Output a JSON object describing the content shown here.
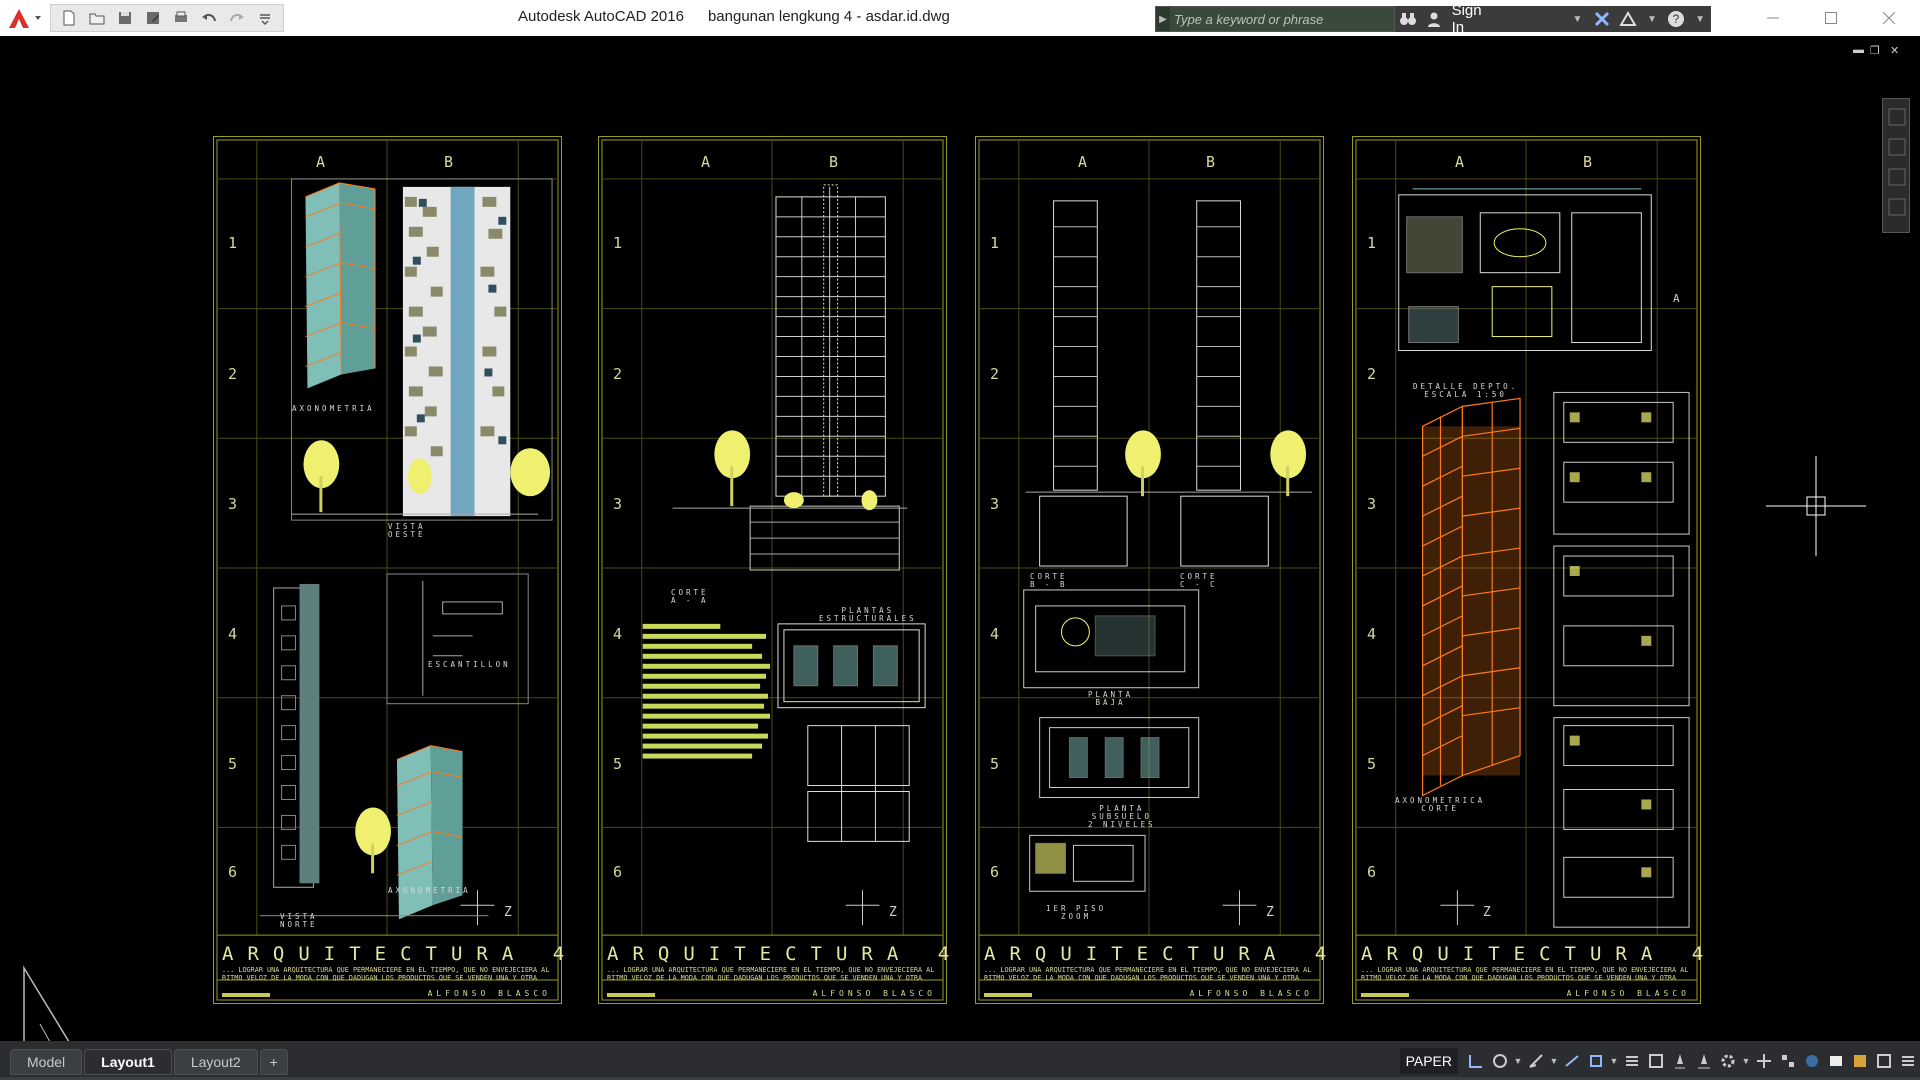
{
  "window": {
    "app_title": "Autodesk AutoCAD 2016",
    "file_title": "bangunan lengkung 4 - asdar.id.dwg"
  },
  "qat_icons": [
    "new-icon",
    "open-icon",
    "save-icon",
    "save-as-icon",
    "print-icon",
    "undo-icon",
    "redo-icon",
    "customize-icon"
  ],
  "search": {
    "placeholder": "Type a keyword or phrase"
  },
  "signin": {
    "label": "Sign In"
  },
  "sheets": [
    {
      "col_a": "A",
      "col_b": "B",
      "rows": [
        "1",
        "2",
        "3",
        "4",
        "5",
        "6"
      ],
      "labels": {
        "axonometria_top": "AXONOMETRIA",
        "vista_oeste": "VISTA\nOESTE",
        "escantillon": "ESCANTILLON",
        "vista_norte": "VISTA\nNORTE",
        "axonometria_bottom": "AXONOMETRIA"
      },
      "compass": "Z",
      "title": "ARQUITECTURA 4",
      "description": "... LOGRAR UNA ARQUITECTURA QUE PERMANECIERE EN EL TIEMPO, QUE NO ENVEJECIERA AL RITMO VELOZ DE LA MODA CON QUE DADUGAN LOS PRODUCTOS QUE SE VENDEN UNA Y OTRA VEZ, DADA TEMPORADA.",
      "author": "ALFONSO BLASCO"
    },
    {
      "col_a": "A",
      "col_b": "B",
      "rows": [
        "1",
        "2",
        "3",
        "4",
        "5",
        "6"
      ],
      "labels": {
        "corte_aa": "CORTE\nA - A",
        "plantas_estructurales": "PLANTAS\nESTRUCTURALES"
      },
      "compass": "Z",
      "title": "ARQUITECTURA 4",
      "description": "... LOGRAR UNA ARQUITECTURA QUE PERMANECIERE EN EL TIEMPO, QUE NO ENVEJECIERA AL RITMO VELOZ DE LA MODA CON QUE DADUGAN LOS PRODUCTOS QUE SE VENDEN UNA Y OTRA VEZ, DADA TEMPORADA.",
      "author": "ALFONSO BLASCO"
    },
    {
      "col_a": "A",
      "col_b": "B",
      "rows": [
        "1",
        "2",
        "3",
        "4",
        "5",
        "6"
      ],
      "labels": {
        "corte_bb": "CORTE\nB - B",
        "corte_cc": "CORTE\nC - C",
        "planta_baja": "PLANTA\nBAJA",
        "planta_subsuelo": "PLANTA\nSUBSUELO\n2 NIVELES",
        "primer_piso": "1ER PISO\nZOOM"
      },
      "compass": "Z",
      "title": "ARQUITECTURA 4",
      "description": "... LOGRAR UNA ARQUITECTURA QUE PERMANECIERE EN EL TIEMPO, QUE NO ENVEJECIERA AL RITMO VELOZ DE LA MODA CON QUE DADUGAN LOS PRODUCTOS QUE SE VENDEN UNA Y OTRA VEZ, DADA TEMPORADA.",
      "author": "ALFONSO BLASCO"
    },
    {
      "col_a": "A",
      "col_b": "B",
      "rows": [
        "1",
        "2",
        "3",
        "4",
        "5",
        "6"
      ],
      "labels": {
        "detalle_depto": "DETALLE DEPTO.\nESCALA 1:50",
        "axonometrica_corte": "AXONOMETRICA\nCORTE",
        "marker_a": "A"
      },
      "compass": "Z",
      "title": "ARQUITECTURA 4",
      "description": "... LOGRAR UNA ARQUITECTURA QUE PERMANECIERE EN EL TIEMPO, QUE NO ENVEJECIERA AL RITMO VELOZ DE LA MODA CON QUE DADUGAN LOS PRODUCTOS QUE SE VENDEN UNA Y OTRA VEZ, DADA TEMPORADA.",
      "author": "ALFONSO BLASCO"
    }
  ],
  "layout_tabs": [
    {
      "label": "Model"
    },
    {
      "label": "Layout1",
      "active": true
    },
    {
      "label": "Layout2"
    },
    {
      "label": "+"
    }
  ],
  "status": {
    "paper_label": "PAPER"
  },
  "colors": {
    "sheet_border": "#9a9a2a",
    "tree_yellow": "#f0f070",
    "axo_orange": "#ff7a1a",
    "teal": "#7fbfb8",
    "grid": "#4a4a14"
  }
}
